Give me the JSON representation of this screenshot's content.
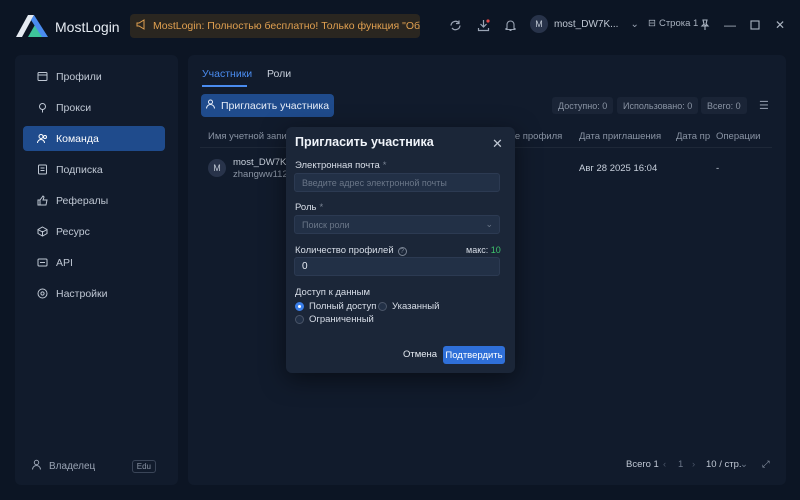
{
  "app": {
    "title": "MostLogin"
  },
  "notice": {
    "text": "MostLogin: Полностью бесплатно! Только функция \"Обл..."
  },
  "header": {
    "user_initial": "M",
    "username": "most_DW7K...",
    "row_label": "Строка 1"
  },
  "sidebar": {
    "items": [
      {
        "label": "Профили",
        "icon": "profile-icon"
      },
      {
        "label": "Прокси",
        "icon": "proxy-icon"
      },
      {
        "label": "Команда",
        "icon": "team-icon",
        "active": true
      },
      {
        "label": "Подписка",
        "icon": "subscription-icon"
      },
      {
        "label": "Рефералы",
        "icon": "referral-icon"
      },
      {
        "label": "Ресурс",
        "icon": "resource-icon"
      },
      {
        "label": "API",
        "icon": "api-icon"
      },
      {
        "label": "Настройки",
        "icon": "settings-icon"
      }
    ],
    "owner_label": "Владелец",
    "badge": "Edu"
  },
  "main": {
    "tabs": [
      {
        "label": "Участники",
        "active": true
      },
      {
        "label": "Роли",
        "active": false
      }
    ],
    "invite_button": "Пригласить участника",
    "stats": {
      "available": "Доступно: 0",
      "used": "Использовано: 0",
      "total": "Всего: 0"
    },
    "table": {
      "headers": [
        "Имя учетной запис",
        "ые профиля",
        "Дата приглашения",
        "Дата пр",
        "Операции"
      ],
      "rows": [
        {
          "initial": "M",
          "name": "most_DW7KQ",
          "email": "zhangww1127",
          "invite_date": "Авг 28 2025 16:04",
          "operation": "-"
        }
      ]
    },
    "pagination": {
      "total": "Всего 1",
      "prev": "‹",
      "page": "1",
      "next": "›",
      "per_page": "10 / стр."
    }
  },
  "modal": {
    "title": "Пригласить участника",
    "email_label": "Электронная почта",
    "email_placeholder": "Введите адрес электронной почты",
    "role_label": "Роль",
    "role_placeholder": "Поиск роли",
    "profiles_label": "Количество профилей",
    "max_label": "макс:",
    "max_value": "10",
    "profiles_value": "0",
    "access_label": "Доступ к данным",
    "access_options": [
      {
        "label": "Полный доступ",
        "checked": true
      },
      {
        "label": "Указанный",
        "checked": false
      },
      {
        "label": "Ограниченный",
        "checked": false
      }
    ],
    "cancel": "Отмена",
    "confirm": "Подтвердить"
  },
  "colors": {
    "accent": "#2f6fd8",
    "active_nav": "#1f4b8c",
    "max_green": "#3ec46d",
    "notice_text": "#e0a050"
  }
}
